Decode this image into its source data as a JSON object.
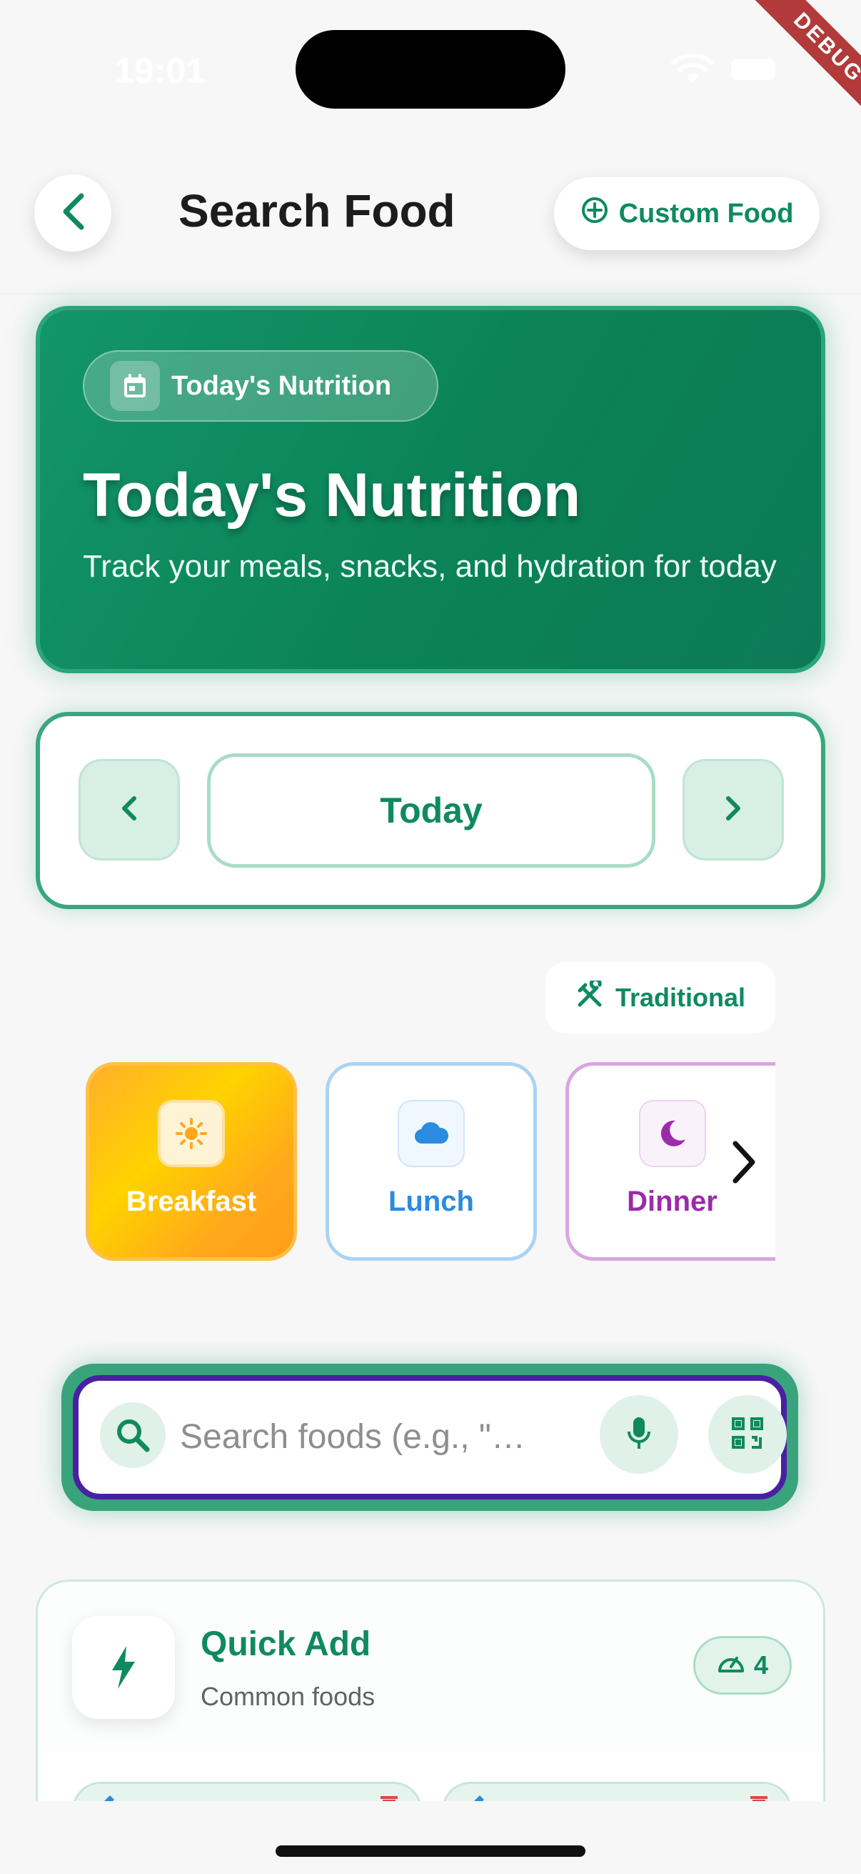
{
  "status_bar": {
    "time": "19:01",
    "debug_label": "DEBUG"
  },
  "header": {
    "title": "Search Food",
    "custom_food_label": "Custom Food"
  },
  "hero": {
    "pill_label": "Today's Nutrition",
    "title": "Today's Nutrition",
    "subtitle": "Track your meals, snacks, and hydration for today"
  },
  "date_nav": {
    "current": "Today"
  },
  "meal_style": {
    "label": "Traditional"
  },
  "meals": [
    {
      "label": "Breakfast",
      "icon": "sun-icon",
      "color": "#ffa81b"
    },
    {
      "label": "Lunch",
      "icon": "cloud-icon",
      "color": "#2b8be0"
    },
    {
      "label": "Dinner",
      "icon": "moon-icon",
      "color": "#9b2ba8"
    }
  ],
  "search": {
    "placeholder": "Search foods (e.g., \"…"
  },
  "quick_add": {
    "title": "Quick Add",
    "subtitle": "Common foods",
    "count": "4"
  },
  "colors": {
    "accent": "#0f8a5f",
    "search_border": "#4b1fa3"
  }
}
